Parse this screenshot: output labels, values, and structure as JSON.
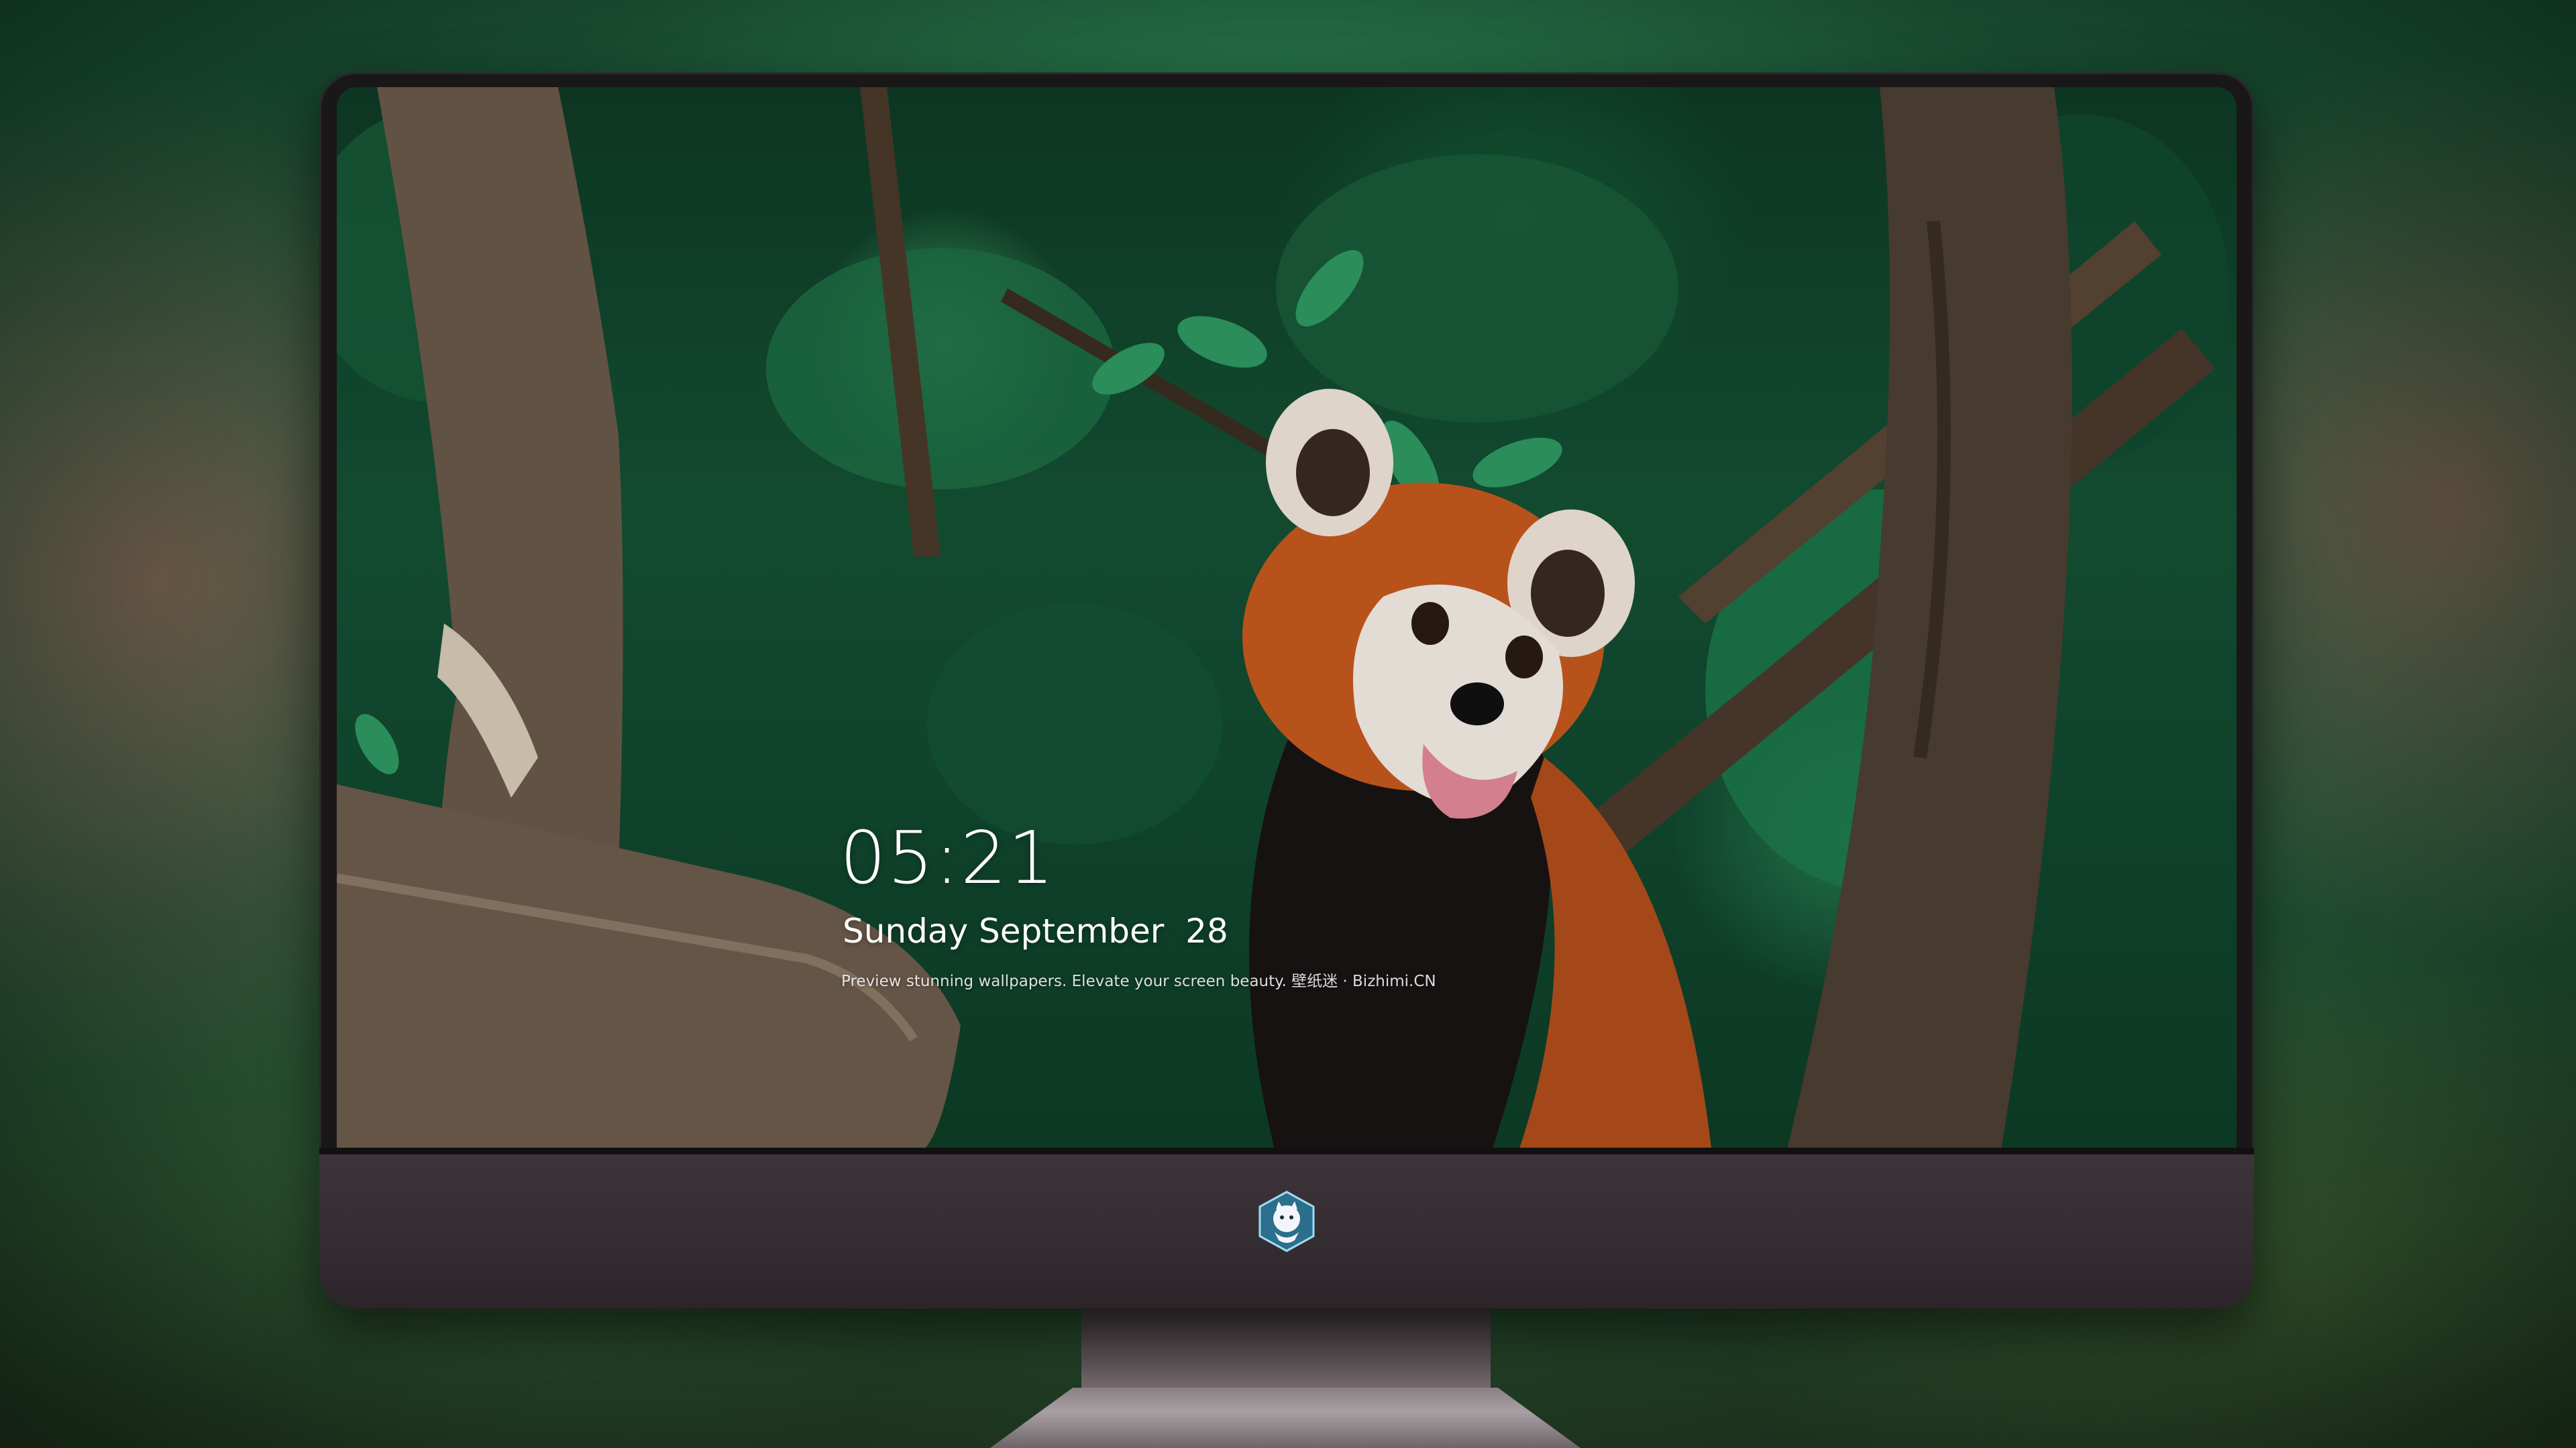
{
  "lock_screen": {
    "time": "05:21",
    "date": "Sunday September  28",
    "tagline": "Preview stunning wallpapers. Elevate your screen beauty. 壁纸迷 · Bizhimi.CN"
  },
  "dock": {
    "apps": [
      {
        "name": "messages-icon",
        "color": "#34c759"
      },
      {
        "name": "weather-icon",
        "color": "#1e88e5"
      },
      {
        "name": "clock-icon",
        "color": "#ffffff"
      },
      {
        "name": "preview-icon",
        "color": "#f5c842"
      },
      {
        "name": "clips-icon",
        "color": "#3fc1e8"
      },
      {
        "name": "notes-icon",
        "color": "#ffd60a"
      },
      {
        "name": "photo-gallery-icon",
        "color": "#f2f2f2"
      }
    ],
    "pinned": [
      {
        "name": "music-icon",
        "color": "#d64bf5"
      },
      {
        "name": "app-store-icon",
        "color": "#1a8cff"
      },
      {
        "name": "camera-icon",
        "color": "#8e8e93"
      }
    ]
  }
}
